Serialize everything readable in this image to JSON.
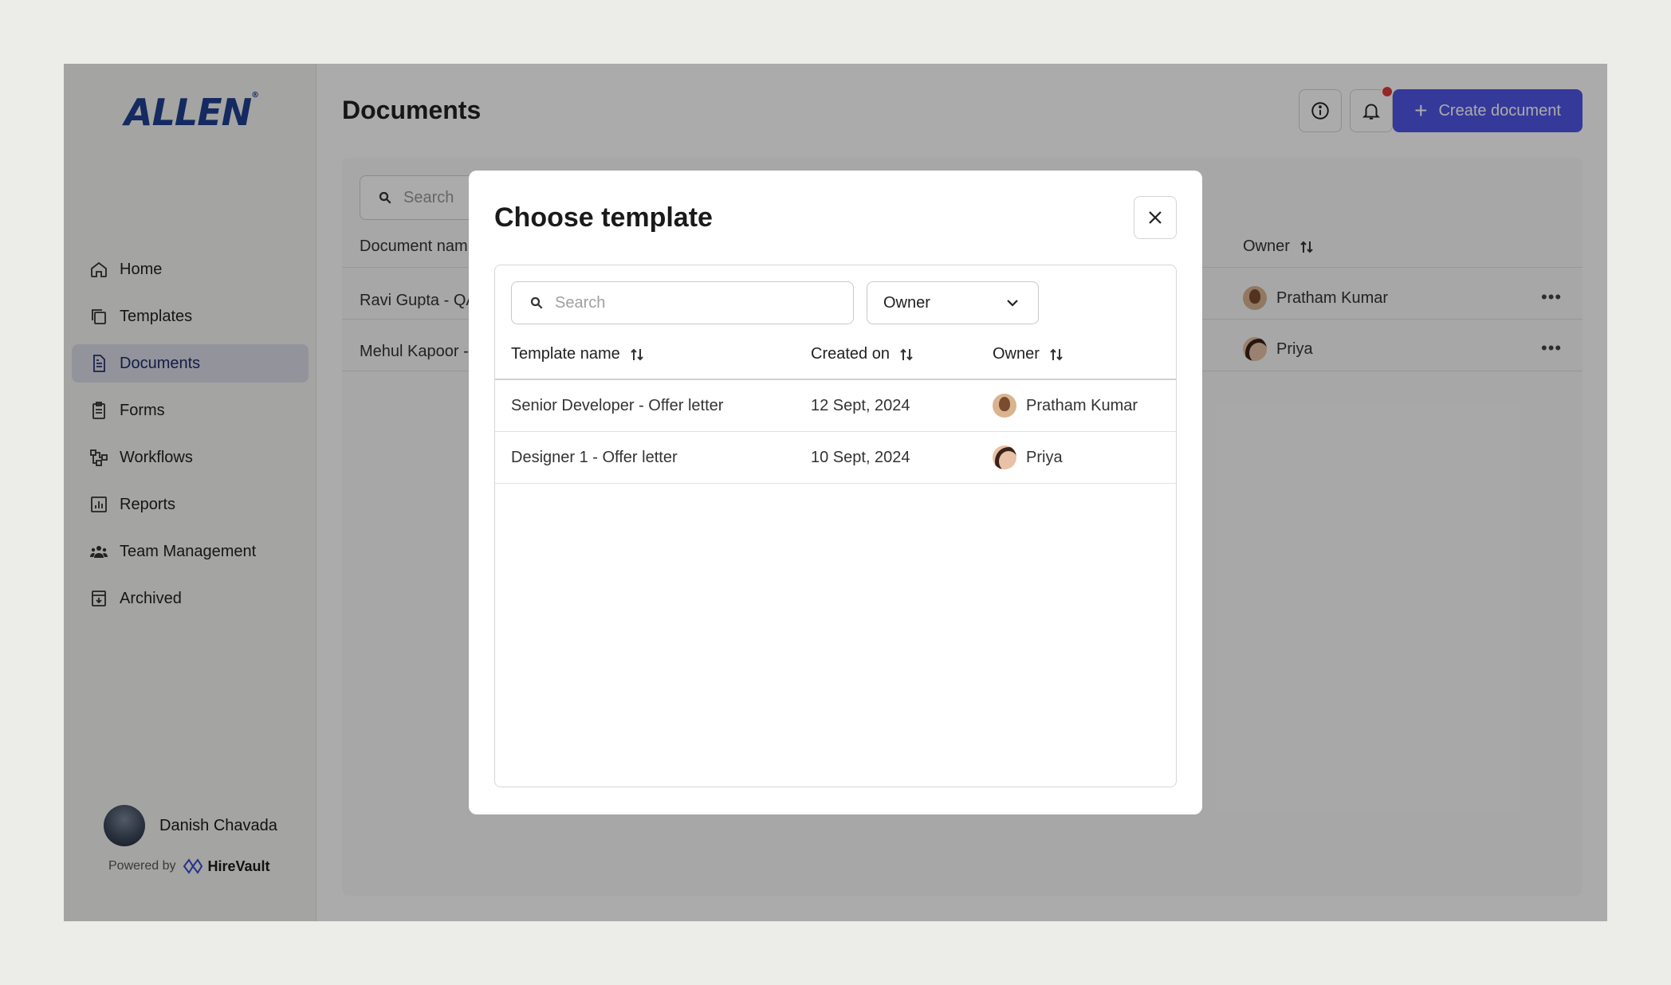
{
  "app": {
    "logo": "ALLEN",
    "logo_mark": "®"
  },
  "sidebar": {
    "items": [
      {
        "label": "Home",
        "icon": "home-icon",
        "active": false
      },
      {
        "label": "Templates",
        "icon": "templates-icon",
        "active": false
      },
      {
        "label": "Documents",
        "icon": "document-icon",
        "active": true
      },
      {
        "label": "Forms",
        "icon": "clipboard-icon",
        "active": false
      },
      {
        "label": "Workflows",
        "icon": "workflow-icon",
        "active": false
      },
      {
        "label": "Reports",
        "icon": "chart-icon",
        "active": false
      },
      {
        "label": "Team Management",
        "icon": "team-icon",
        "active": false
      },
      {
        "label": "Archived",
        "icon": "archive-icon",
        "active": false
      }
    ],
    "user": {
      "name": "Danish Chavada"
    },
    "powered_by": {
      "prefix": "Powered by",
      "brand": "HireVault"
    }
  },
  "header": {
    "title": "Documents",
    "create_label": "Create document"
  },
  "background_table": {
    "search_placeholder": "Search",
    "col_document": "Document nam",
    "col_owner": "Owner",
    "rows": [
      {
        "name": "Ravi Gupta - QA",
        "owner": "Pratham Kumar"
      },
      {
        "name": "Mehul Kapoor -",
        "owner": "Priya"
      }
    ]
  },
  "modal": {
    "title": "Choose template",
    "search_placeholder": "Search",
    "owner_filter": "Owner",
    "columns": {
      "name": "Template name",
      "created": "Created on",
      "owner": "Owner"
    },
    "rows": [
      {
        "name": "Senior Developer - Offer letter",
        "created": "12 Sept, 2024",
        "owner": "Pratham Kumar"
      },
      {
        "name": "Designer 1 - Offer letter",
        "created": "10 Sept, 2024",
        "owner": "Priya"
      }
    ]
  },
  "colors": {
    "accent": "#4f55e6",
    "notification": "#e03b3b",
    "brand": "#1f3f8f",
    "active_nav": "#dcdde8"
  }
}
